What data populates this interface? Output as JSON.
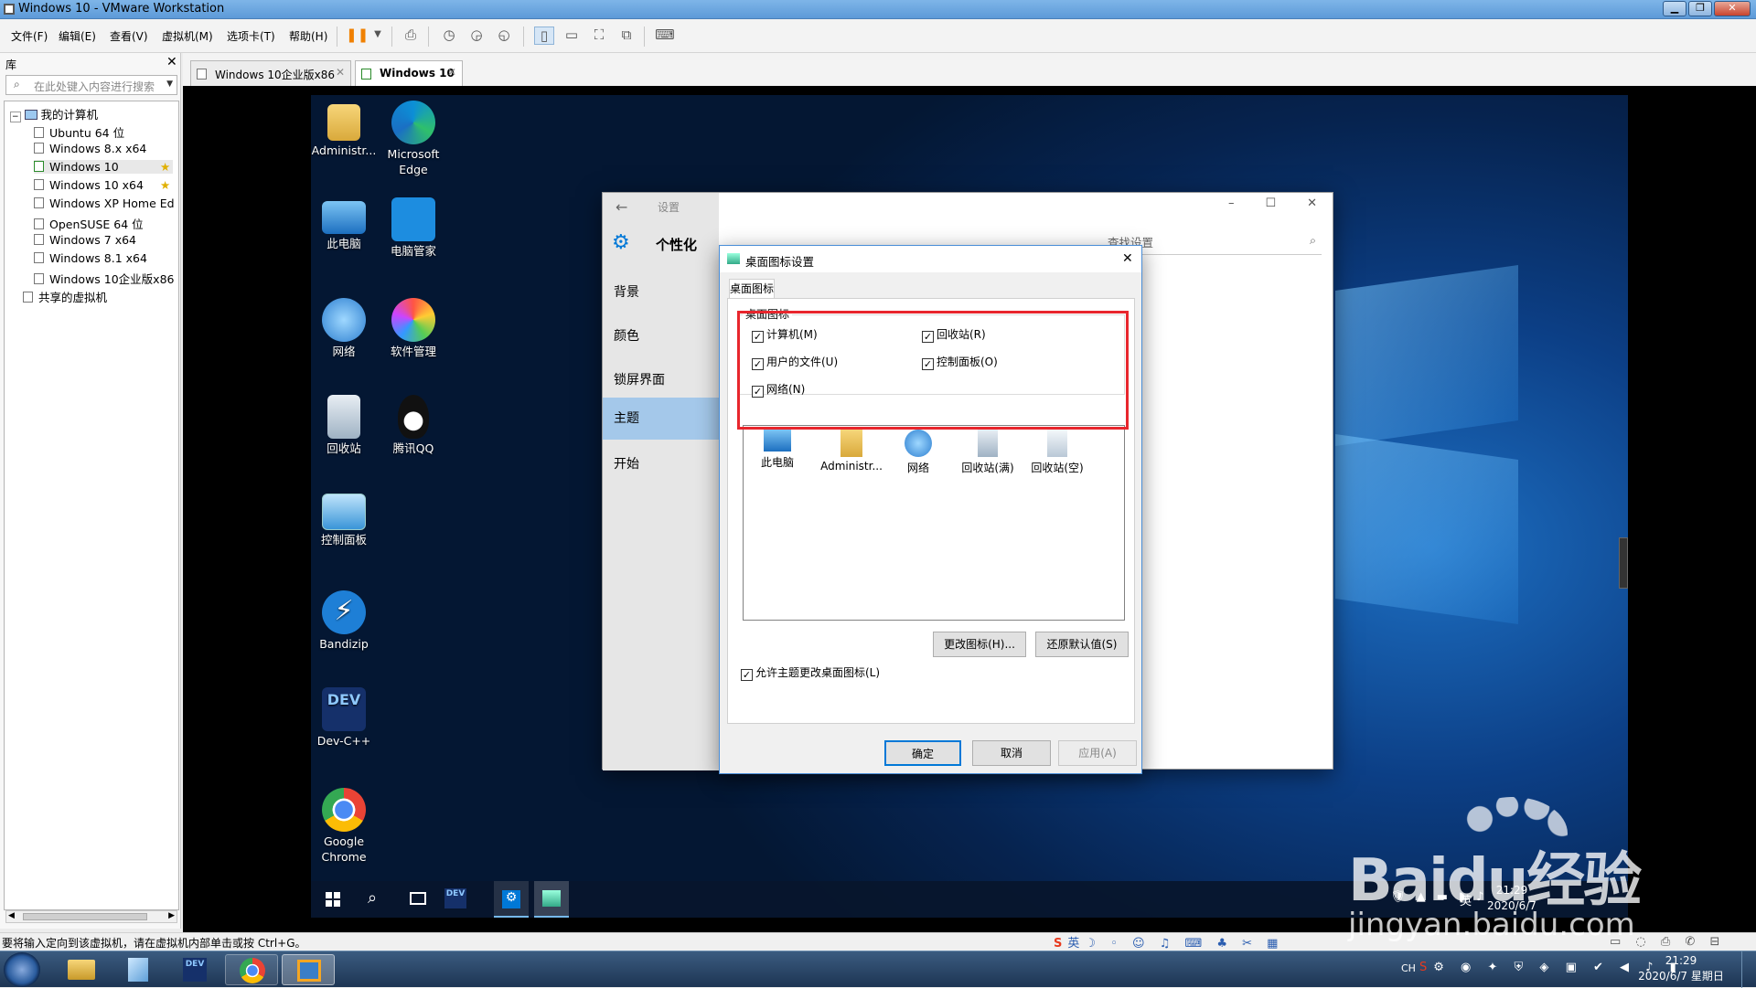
{
  "window": {
    "title": "Windows 10 - VMware Workstation"
  },
  "menu": [
    "文件(F)",
    "编辑(E)",
    "查看(V)",
    "虚拟机(M)",
    "选项卡(T)",
    "帮助(H)"
  ],
  "library": {
    "title": "库",
    "search_placeholder": "在此处键入内容进行搜索",
    "root": "我的计算机",
    "vms": [
      "Ubuntu 64 位",
      "Windows 8.x x64",
      "Windows 10",
      "Windows 10 x64",
      "Windows XP Home Ed",
      "OpenSUSE 64 位",
      "Windows 7 x64",
      "Windows 8.1 x64",
      "Windows 10企业版x86"
    ],
    "shared": "共享的虚拟机"
  },
  "tabs": [
    {
      "label": "Windows 10企业版x86",
      "active": false
    },
    {
      "label": "Windows 10",
      "active": true
    }
  ],
  "desktop_icons": [
    {
      "label": "Administr...",
      "icon": "user-folder-icon"
    },
    {
      "label": "Microsoft Edge",
      "icon": "edge-icon"
    },
    {
      "label": "此电脑",
      "icon": "computer-icon"
    },
    {
      "label": "电脑管家",
      "icon": "shield-icon"
    },
    {
      "label": "网络",
      "icon": "network-icon"
    },
    {
      "label": "软件管理",
      "icon": "clover-icon"
    },
    {
      "label": "回收站",
      "icon": "recycle-bin-icon"
    },
    {
      "label": "腾讯QQ",
      "icon": "qq-penguin-icon"
    },
    {
      "label": "控制面板",
      "icon": "control-panel-icon"
    },
    {
      "label": "Bandizip",
      "icon": "bandizip-icon"
    },
    {
      "label": "Dev-C++",
      "icon": "devcpp-icon"
    },
    {
      "label": "Google Chrome",
      "icon": "chrome-icon"
    }
  ],
  "settings": {
    "title": "设置",
    "header": "个性化",
    "search_placeholder": "查找设置",
    "nav": [
      "背景",
      "颜色",
      "锁屏界面",
      "主题",
      "开始"
    ],
    "active_nav": "主题"
  },
  "dialog": {
    "title": "桌面图标设置",
    "tab": "桌面图标",
    "group": "桌面图标",
    "checkboxes": [
      {
        "label": "计算机(M)",
        "checked": true
      },
      {
        "label": "回收站(R)",
        "checked": true
      },
      {
        "label": "用户的文件(U)",
        "checked": true
      },
      {
        "label": "控制面板(O)",
        "checked": true
      },
      {
        "label": "网络(N)",
        "checked": true
      }
    ],
    "preview": [
      {
        "label": "此电脑",
        "icon": "computer-icon"
      },
      {
        "label": "Administr...",
        "icon": "user-folder-icon"
      },
      {
        "label": "网络",
        "icon": "network-icon"
      },
      {
        "label": "回收站(满)",
        "icon": "recycle-bin-full-icon"
      },
      {
        "label": "回收站(空)",
        "icon": "recycle-bin-empty-icon"
      }
    ],
    "change_icon": "更改图标(H)...",
    "restore_default": "还原默认值(S)",
    "allow_theme": "允许主题更改桌面图标(L)",
    "ok": "确定",
    "cancel": "取消",
    "apply": "应用(A)"
  },
  "guest_clock": {
    "time": "21:29",
    "date": "2020/6/7",
    "lang": "英"
  },
  "status_text": "要将输入定向到该虚拟机，请在虚拟机内部单击或按 Ctrl+G。",
  "host_clock": {
    "time": "21:29",
    "date": "2020/6/7 星期日",
    "lang": "CH"
  },
  "ime_lang": "英",
  "watermark": {
    "main": "Baidu经验",
    "sub": "jingyan.baidu.com"
  },
  "colors": {
    "highlight_box": "#e8262d",
    "accent": "#0078d7"
  }
}
